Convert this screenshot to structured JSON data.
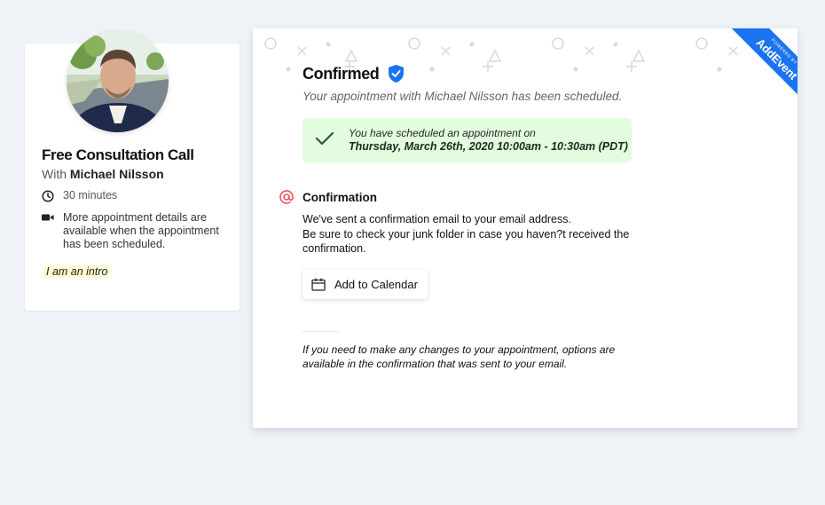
{
  "event": {
    "title": "Free Consultation Call",
    "host_prefix": "With",
    "host_name": "Michael Nilsson",
    "duration": "30 minutes",
    "details": "More appointment details are available when the appointment has been scheduled.",
    "intro": "I am an intro",
    "icons": {
      "duration": "clock-icon",
      "details": "video-camera-icon"
    }
  },
  "confirmation": {
    "title": "Confirmed",
    "title_icon": "verified-shield-icon",
    "subtitle": "Your appointment with Michael Nilsson has been scheduled.",
    "success": {
      "line1": "You have scheduled an appointment on",
      "line2": "Thursday, March 26th, 2020 10:00am - 10:30am (PDT)"
    },
    "section": {
      "icon": "at-sign-icon",
      "title": "Confirmation",
      "line1": "We've sent a confirmation email to your email address.",
      "line2": "Be sure to check your junk folder in case you haven?t received the confirmation."
    },
    "add_to_calendar_label": "Add to Calendar",
    "footer_note": "If you need to make any changes to your appointment, options are available in the confirmation that was sent to your email."
  },
  "ribbon": {
    "powered_by": "POWERED BY",
    "brand": "AddEvent"
  },
  "colors": {
    "accent_blue": "#1a73f0",
    "success_bg": "#e3fbdf",
    "at_icon": "#f0525f",
    "page_bg": "#eff2f7"
  }
}
